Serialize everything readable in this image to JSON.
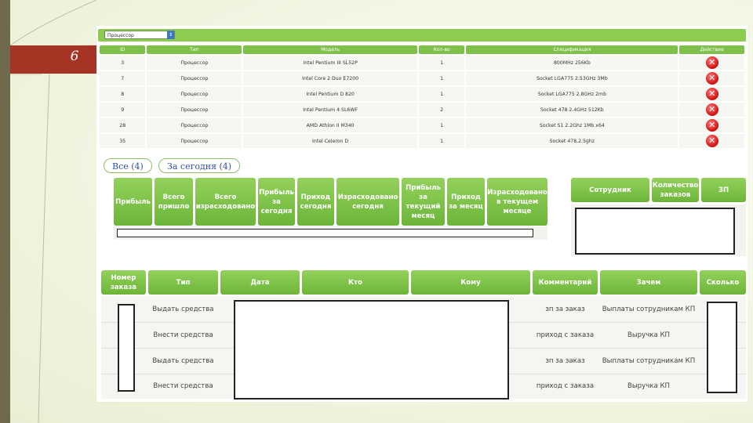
{
  "slide": {
    "number": "6"
  },
  "filter": {
    "selected": "Процессор"
  },
  "components": {
    "headers": [
      "ID",
      "Тип",
      "Модель",
      "Кол-во",
      "Спецификация",
      "Действие"
    ],
    "rows": [
      [
        "3",
        "Процессор",
        "Intel Pentium III SL52P",
        "1",
        "800MHz 256Kb"
      ],
      [
        "7",
        "Процессор",
        "Intel Core 2 Duo E7200",
        "1",
        "Socket LGA775 2.53GHz 3Mb"
      ],
      [
        "8",
        "Процессор",
        "Intel Pentium D 820",
        "1",
        "Socket LGA775 2.8GHz 2mb"
      ],
      [
        "9",
        "Процессор",
        "Intel Pentium 4 SL6WF",
        "2",
        "Socket 478 2.4GHz 512Kb"
      ],
      [
        "28",
        "Процессор",
        "AMD Athlon II M340",
        "1",
        "Socket S1 2.2Ghz 1Mb x64"
      ],
      [
        "35",
        "Процессор",
        "Intel Celeron D",
        "1",
        "Socket 478,2.5ghz"
      ]
    ]
  },
  "period_tabs": {
    "all": "Все (4)",
    "today": "За сегодня (4)"
  },
  "stats": {
    "headers": [
      "Прибыль",
      "Всего пришло",
      "Всего израсходовано",
      "Прибыль за сегодня",
      "Приход сегодня",
      "Израсходовано сегодня",
      "Прибыль за текущий месяц",
      "Приход за месяц",
      "Израсходовано в текущем месяце"
    ]
  },
  "employees": {
    "headers": [
      "Сотрудник",
      "Количество заказов",
      "ЗП"
    ]
  },
  "operations": {
    "headers": [
      "Номер заказа",
      "Тип",
      "Дата",
      "Кто",
      "Кому",
      "Комментарий",
      "Зачем",
      "Сколько"
    ],
    "rows": [
      {
        "type": "Выдать средства",
        "comment": "зп за заказ",
        "purpose": "Выплаты сотрудникам КП"
      },
      {
        "type": "Внести средства",
        "comment": "приход с заказа",
        "purpose": "Выручка КП"
      },
      {
        "type": "Выдать средства",
        "comment": "зп за заказ",
        "purpose": "Выплаты сотрудникам КП"
      },
      {
        "type": "Внести средства",
        "comment": "приход с заказа",
        "purpose": "Выручка КП"
      }
    ]
  },
  "colors": {
    "header_green": "#7fc04a",
    "accent_red": "#a53424",
    "link_blue": "#2f4faa"
  }
}
